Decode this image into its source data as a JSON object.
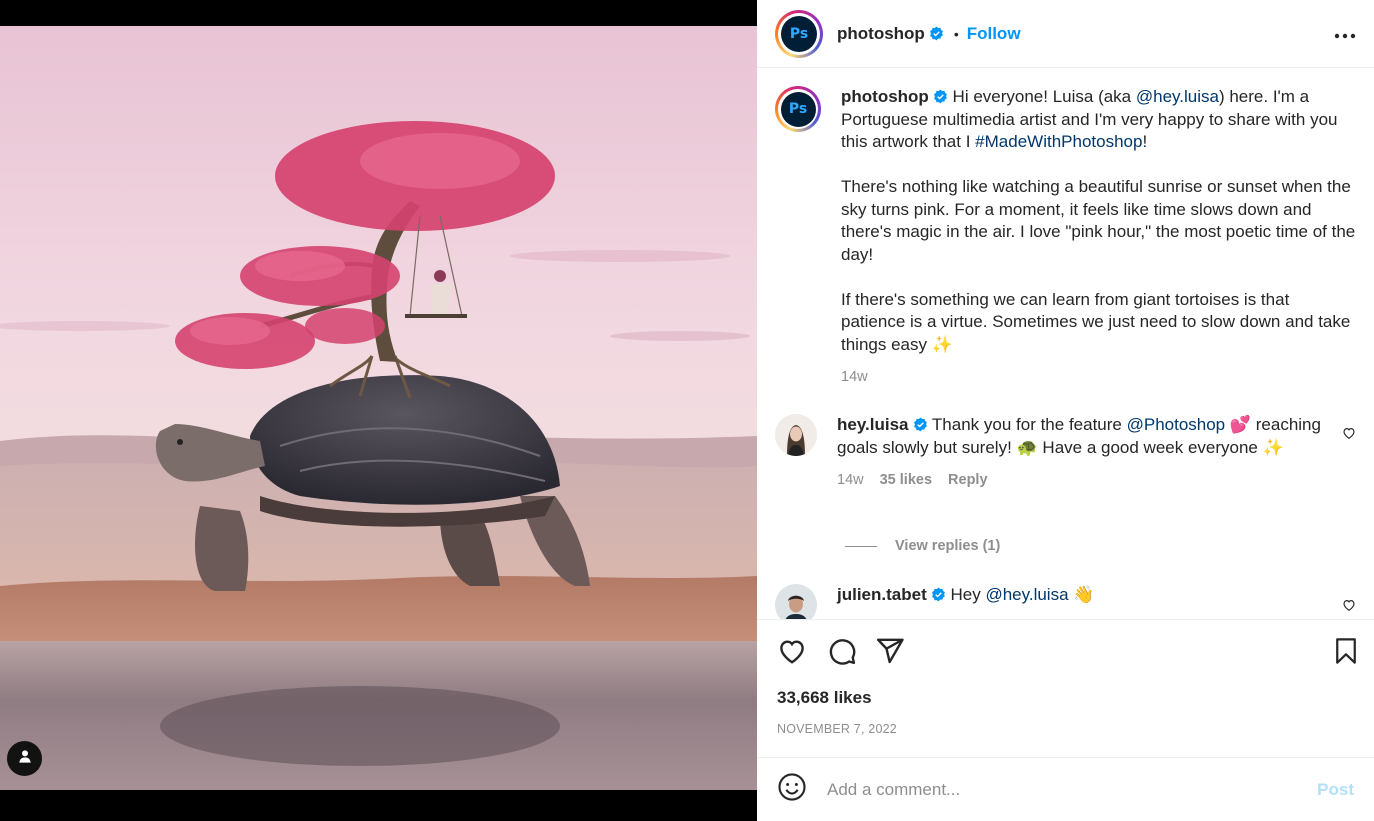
{
  "post": {
    "username": "photoshop",
    "follow_label": "Follow",
    "separator": "•",
    "avatar_text": "Ps"
  },
  "caption": {
    "username": "photoshop",
    "p1_a": "Hi everyone! Luisa (aka ",
    "p1_mention": "@hey.luisa",
    "p1_b": ") here. I'm a Portuguese multimedia artist and I'm very happy to share with you this artwork that I ",
    "p1_hashtag": "#MadeWithPhotoshop",
    "p1_c": "!",
    "p2": "There's nothing like watching a beautiful sunrise or sunset when the sky turns pink. For a moment, it feels like time slows down and there's magic in the air. I love \"pink hour,\" the most poetic time of the day!",
    "p3": "If there's something we can learn from giant tortoises is that patience is a virtue. Sometimes we just need to slow down and take things easy ✨",
    "time": "14w"
  },
  "comments": [
    {
      "username": "hey.luisa",
      "text_a": "Thank you for the feature ",
      "mention": "@Photoshop",
      "text_b": " 💕 reaching goals slowly but surely! 🐢 Have a good week everyone ✨",
      "time": "14w",
      "likes": "35 likes",
      "reply_label": "Reply",
      "view_replies": "View replies (1)"
    },
    {
      "username": "julien.tabet",
      "text_a": "Hey ",
      "mention": "@hey.luisa",
      "text_b": " 👋"
    }
  ],
  "stats": {
    "likes": "33,668 likes",
    "date": "NOVEMBER 7, 2022"
  },
  "composer": {
    "placeholder": "Add a comment...",
    "post_label": "Post"
  },
  "icons": [
    "user-tag-icon",
    "verified-icon",
    "more-icon",
    "heart-icon",
    "comment-icon",
    "share-icon",
    "bookmark-icon",
    "emoji-icon"
  ],
  "colors": {
    "link": "#00376b",
    "follow": "#0095f6",
    "muted": "#8e8e8e",
    "verified": "#0095f6"
  }
}
